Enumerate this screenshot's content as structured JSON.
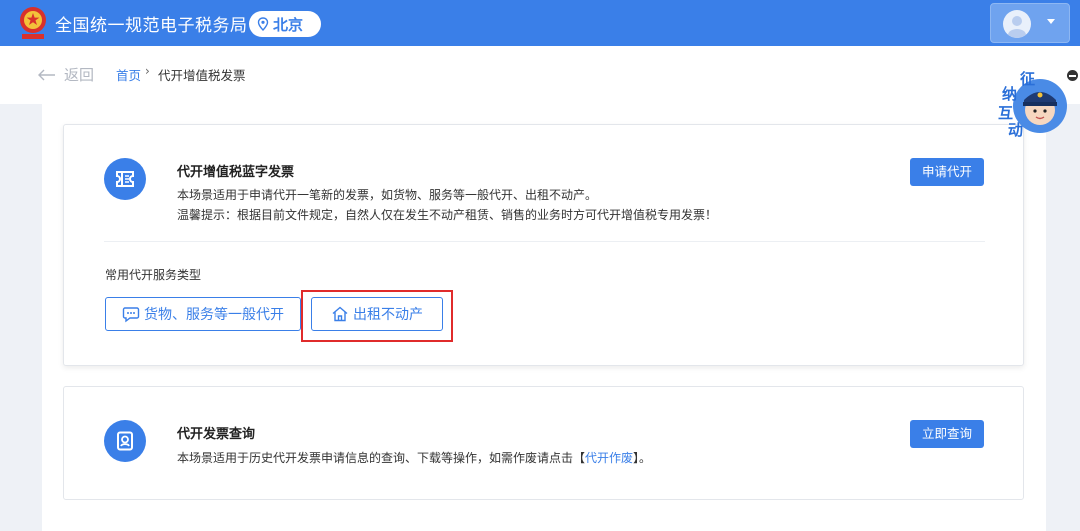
{
  "header": {
    "site_title": "全国统一规范电子税务局",
    "city": "北京",
    "icons": {
      "emblem": "national-emblem-icon",
      "location": "location-pin-icon",
      "user": "user-avatar-icon",
      "dropdown": "caret-down-icon"
    }
  },
  "breadcrumb": {
    "back_label": "返回",
    "home": "首页",
    "separator": "›",
    "current": "代开增值税发票"
  },
  "blue_invoice_card": {
    "title": "代开增值税蓝字发票",
    "description": "本场景适用于申请代开一笔新的发票，如货物、服务等一般代开、出租不动产。",
    "tip": "温馨提示：根据目前文件规定，自然人仅在发生不动产租赁、销售的业务时方可代开增值税专用发票！",
    "action_label": "申请代开",
    "services_label": "常用代开服务类型",
    "services": [
      {
        "label": "货物、服务等一般代开",
        "icon": "chat-bubble-icon"
      },
      {
        "label": "出租不动产",
        "icon": "house-icon"
      }
    ]
  },
  "query_card": {
    "title": "代开发票查询",
    "description_prefix": "本场景适用于历史代开发票申请信息的查询、下载等操作，如需作废请点击【",
    "description_link": "代开作废",
    "description_suffix": "】。",
    "action_label": "立即查询"
  },
  "helper_widget": {
    "chars": [
      "征",
      "纳",
      "互",
      "动"
    ]
  },
  "colors": {
    "brand_blue": "#3a7fe8",
    "highlight_red": "#e02b2b",
    "page_bg": "#eef1f6"
  }
}
